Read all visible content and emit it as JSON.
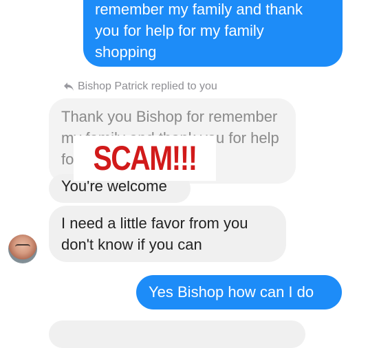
{
  "thread": {
    "top_outgoing": [
      "remember my family and thank",
      "you for help for my family",
      "shopping"
    ],
    "reply_notice": "Bishop Patrick replied to you",
    "quoted_lines": [
      "Thank you Bishop for remember",
      "my family and thank you for help",
      "for"
    ],
    "welcome": "You're welcome",
    "favor_lines": [
      "I need a little favor from you",
      "don't know if you can"
    ],
    "yes_reply": "Yes Bishop how can I do"
  },
  "overlay": {
    "stamp_text": "SCAM!!!"
  },
  "colors": {
    "outgoing": "#1d8cf8",
    "incoming": "#f0f0f0",
    "stamp": "#d11a1a"
  },
  "icons": {
    "reply": "reply-arrow-icon",
    "avatar": "avatar"
  }
}
